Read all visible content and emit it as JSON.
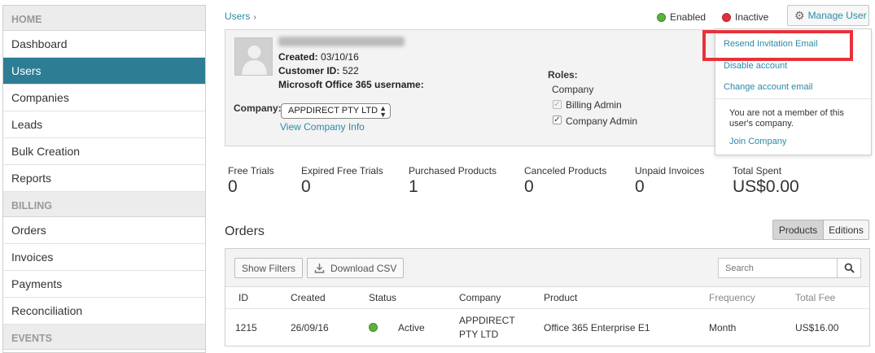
{
  "sidebar": {
    "sections": [
      {
        "title": "HOME",
        "items": [
          "Dashboard",
          "Users",
          "Companies",
          "Leads",
          "Bulk Creation",
          "Reports"
        ]
      },
      {
        "title": "BILLING",
        "items": [
          "Orders",
          "Invoices",
          "Payments",
          "Reconciliation"
        ]
      },
      {
        "title": "EVENTS",
        "items": []
      }
    ],
    "active_item": "Users"
  },
  "breadcrumb": {
    "link": "Users",
    "separator": "›"
  },
  "legend": {
    "enabled": "Enabled",
    "inactive": "Inactive",
    "enabled_color": "#5cb03c",
    "inactive_color": "#e0313f"
  },
  "manage_user": {
    "label": "Manage User",
    "icon": "gear-icon"
  },
  "user": {
    "created_label": "Created:",
    "created_value": "03/10/16",
    "customer_id_label": "Customer ID:",
    "customer_id_value": "522",
    "o365_label": "Microsoft Office 365 username:",
    "company_label": "Company:",
    "company_value": "APPDIRECT PTY LTD",
    "view_company": "View Company Info",
    "roles_title": "Roles:",
    "roles": [
      {
        "label": "Company",
        "type": "text"
      },
      {
        "label": "Billing Admin",
        "type": "checkbox",
        "checked": true,
        "disabled": true
      },
      {
        "label": "Company Admin",
        "type": "checkbox",
        "checked": true,
        "disabled": false
      }
    ]
  },
  "dropdown": {
    "items": [
      "Resend Invitation Email",
      "Disable account",
      "Change account email"
    ],
    "note": "You are not a member of this user's company.",
    "join": "Join Company",
    "highlight_color": "#e8313a"
  },
  "stats": [
    {
      "label": "Free Trials",
      "value": "0"
    },
    {
      "label": "Expired Free Trials",
      "value": "0"
    },
    {
      "label": "Purchased Products",
      "value": "1"
    },
    {
      "label": "Canceled Products",
      "value": "0"
    },
    {
      "label": "Unpaid Invoices",
      "value": "0"
    },
    {
      "label": "Total Spent",
      "value": "US$0.00"
    }
  ],
  "orders": {
    "title": "Orders",
    "tabs": [
      "Products",
      "Editions"
    ],
    "active_tab": "Products",
    "show_filters": "Show Filters",
    "download_csv": "Download CSV",
    "search_placeholder": "Search",
    "columns": [
      "ID",
      "Created",
      "Status",
      "Company",
      "Product",
      "Frequency",
      "Total Fee"
    ],
    "rows": [
      {
        "id": "1215",
        "created": "26/09/16",
        "status": "Active",
        "company_line1": "APPDIRECT",
        "company_line2": "PTY LTD",
        "product": "Office 365 Enterprise E1",
        "frequency": "Month",
        "total_fee": "US$16.00"
      }
    ]
  }
}
